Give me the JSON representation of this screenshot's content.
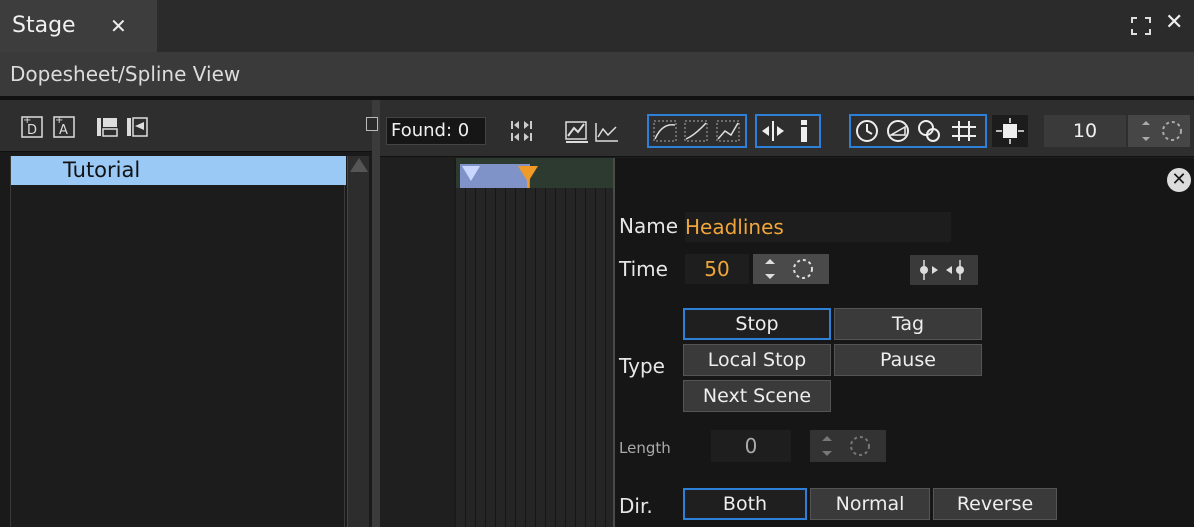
{
  "tab": {
    "title": "Stage",
    "close_glyph": "✕"
  },
  "window_controls": {
    "expand_icon": "expand-icon",
    "close_glyph": "✕"
  },
  "subheader": {
    "title": "Dopesheet/Spline View"
  },
  "left_toolbar": {
    "icons": [
      "add-director-icon",
      "add-actor-icon",
      "add-stop-icon",
      "add-tag-icon"
    ]
  },
  "tree": {
    "items": [
      {
        "label": "Tutorial",
        "selected": true
      }
    ]
  },
  "right_toolbar": {
    "found_text": "Found: 0",
    "zoom_value": "10",
    "icons": [
      "goto-keys-icon",
      "graph-icon",
      "line-icon",
      "spline-icon-1",
      "spline-icon-2",
      "spline-icon-3",
      "move-icon",
      "info-icon",
      "clock-icon",
      "clock-search-icon",
      "clock-filter-icon",
      "grid-icon",
      "snap-icon"
    ]
  },
  "props": {
    "close_glyph": "✕",
    "name_label": "Name",
    "name_value": "Headlines",
    "time_label": "Time",
    "time_value": "50",
    "type_label": "Type",
    "type_buttons": [
      "Stop",
      "Tag",
      "Local Stop",
      "Pause",
      "Next Scene"
    ],
    "type_selected": "Stop",
    "length_label": "Length",
    "length_value": "0",
    "dir_label": "Dir.",
    "dir_buttons": [
      "Both",
      "Normal",
      "Reverse"
    ],
    "dir_selected": "Both"
  },
  "colors": {
    "accent": "#2d7fd7",
    "value_text": "#f0a53a",
    "selection": "#9ac9f5"
  }
}
